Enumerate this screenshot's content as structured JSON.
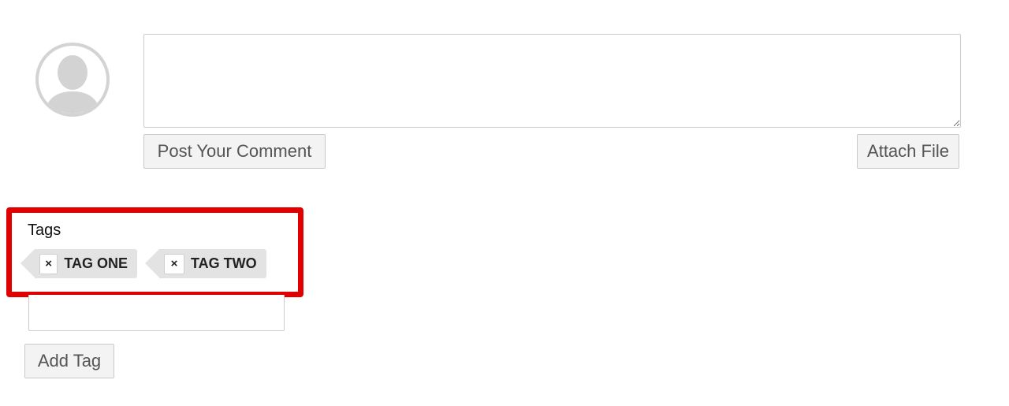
{
  "comment": {
    "avatar_icon": "user-silhouette-icon",
    "textarea_value": "",
    "post_button_label": "Post Your Comment",
    "attach_button_label": "Attach File"
  },
  "tags": {
    "label": "Tags",
    "remove_icon_glyph": "×",
    "items": [
      {
        "label": "TAG ONE"
      },
      {
        "label": "TAG TWO"
      }
    ],
    "input_value": "",
    "add_button_label": "Add Tag"
  },
  "colors": {
    "highlight": "#e00000",
    "tag_background": "#e3e3e3",
    "button_background": "#f3f3f3",
    "avatar_gray": "#d3d3d3"
  }
}
